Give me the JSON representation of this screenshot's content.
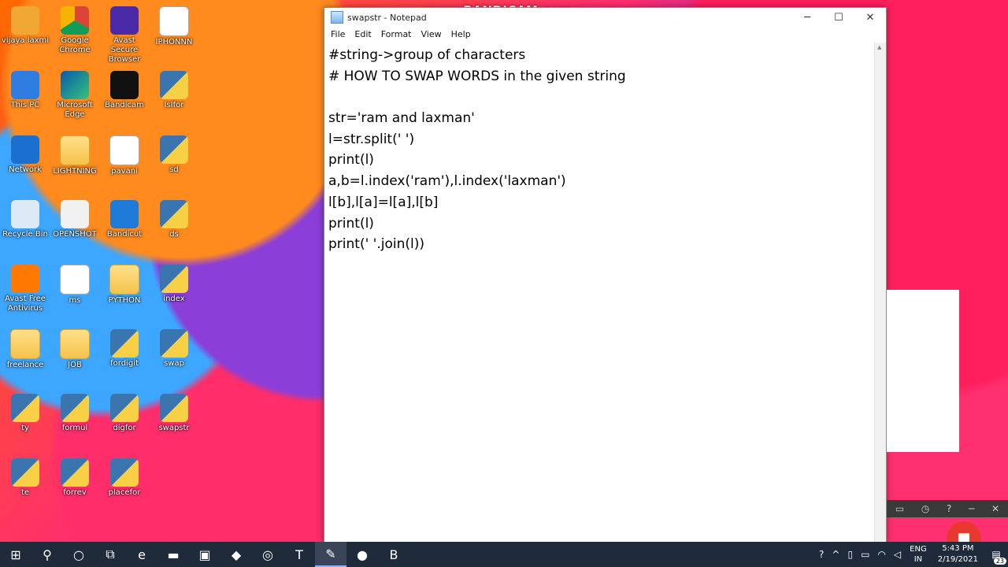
{
  "desktop_icons": [
    {
      "label": "vijaya laxmi",
      "icon": "user-folder-icon",
      "style": "g-user",
      "col": 0,
      "row": 0
    },
    {
      "label": "Google Chrome",
      "icon": "chrome-icon",
      "style": "g-chrome",
      "col": 1,
      "row": 0
    },
    {
      "label": "Avast Secure Browser",
      "icon": "avast-browser-icon",
      "style": "g-avastb",
      "col": 2,
      "row": 0
    },
    {
      "label": "IPHONNN",
      "icon": "document-icon",
      "style": "g-doc",
      "col": 3,
      "row": 0
    },
    {
      "label": "This PC",
      "icon": "computer-icon",
      "style": "g-pc",
      "col": 0,
      "row": 1
    },
    {
      "label": "Microsoft Edge",
      "icon": "edge-icon",
      "style": "g-edge",
      "col": 1,
      "row": 1
    },
    {
      "label": "Bandicam",
      "icon": "bandicam-icon",
      "style": "g-band",
      "col": 2,
      "row": 1
    },
    {
      "label": "lsIfor",
      "icon": "python-file-icon",
      "style": "g-py",
      "col": 3,
      "row": 1
    },
    {
      "label": "Network",
      "icon": "network-icon",
      "style": "g-net",
      "col": 0,
      "row": 2
    },
    {
      "label": "LIGHTNING",
      "icon": "folder-icon",
      "style": "g-folder",
      "col": 1,
      "row": 2
    },
    {
      "label": "pavani",
      "icon": "document-icon",
      "style": "g-doc",
      "col": 2,
      "row": 2
    },
    {
      "label": "sd",
      "icon": "python-file-icon",
      "style": "g-py",
      "col": 3,
      "row": 2
    },
    {
      "label": "Recycle Bin",
      "icon": "recycle-bin-icon",
      "style": "g-bin",
      "col": 0,
      "row": 3
    },
    {
      "label": "OPENSHOT",
      "icon": "openshot-icon",
      "style": "g-open",
      "col": 1,
      "row": 3
    },
    {
      "label": "Bandicut",
      "icon": "bandicut-icon",
      "style": "g-bcut",
      "col": 2,
      "row": 3
    },
    {
      "label": "ds",
      "icon": "python-file-icon",
      "style": "g-py",
      "col": 3,
      "row": 3
    },
    {
      "label": "Avast Free Antivirus",
      "icon": "avast-icon",
      "style": "g-avast",
      "col": 0,
      "row": 4
    },
    {
      "label": "ms",
      "icon": "document-icon",
      "style": "g-doc",
      "col": 1,
      "row": 4
    },
    {
      "label": "PYTHON",
      "icon": "folder-icon",
      "style": "g-folder",
      "col": 2,
      "row": 4
    },
    {
      "label": "index",
      "icon": "python-file-icon",
      "style": "g-py",
      "col": 3,
      "row": 4
    },
    {
      "label": "freelance",
      "icon": "folder-icon",
      "style": "g-folder",
      "col": 0,
      "row": 5
    },
    {
      "label": "JOB",
      "icon": "folder-icon",
      "style": "g-folder",
      "col": 1,
      "row": 5
    },
    {
      "label": "fordigit",
      "icon": "python-file-icon",
      "style": "g-py",
      "col": 2,
      "row": 5
    },
    {
      "label": "swap",
      "icon": "python-file-icon",
      "style": "g-py",
      "col": 3,
      "row": 5
    },
    {
      "label": "ty",
      "icon": "python-file-icon",
      "style": "g-py",
      "col": 0,
      "row": 6
    },
    {
      "label": "formul",
      "icon": "python-file-icon",
      "style": "g-py",
      "col": 1,
      "row": 6
    },
    {
      "label": "digfor",
      "icon": "python-file-icon",
      "style": "g-py",
      "col": 2,
      "row": 6
    },
    {
      "label": "swapstr",
      "icon": "python-file-icon",
      "style": "g-py",
      "col": 3,
      "row": 6
    },
    {
      "label": "te",
      "icon": "python-file-icon",
      "style": "g-py",
      "col": 0,
      "row": 7
    },
    {
      "label": "forrev",
      "icon": "python-file-icon",
      "style": "g-py",
      "col": 1,
      "row": 7
    },
    {
      "label": "placefor",
      "icon": "python-file-icon",
      "style": "g-py",
      "col": 2,
      "row": 7
    }
  ],
  "watermark": "www.BANDICAM.com",
  "notepad": {
    "title": "swapstr - Notepad",
    "menu": [
      "File",
      "Edit",
      "Format",
      "View",
      "Help"
    ],
    "controls": {
      "minimize": "─",
      "maximize": "☐",
      "close": "✕"
    },
    "lines": [
      "#string->group of characters",
      "# HOW TO SWAP WORDS in the given string",
      "",
      "str='ram and laxman'",
      "l=str.split(' ')",
      "print(l)",
      "a,b=l.index('ram'),l.index('laxman')",
      "l[b],l[a]=l[a],l[b]",
      "print(l)",
      "print(' '.join(l))"
    ]
  },
  "taskbar": {
    "apps": [
      {
        "name": "start-button",
        "glyph": "⊞",
        "active": false
      },
      {
        "name": "search-button",
        "glyph": "⚲",
        "active": false
      },
      {
        "name": "cortana-button",
        "glyph": "○",
        "active": false
      },
      {
        "name": "task-view-button",
        "glyph": "⧉",
        "active": false
      },
      {
        "name": "edge-taskbar-button",
        "glyph": "e",
        "active": false
      },
      {
        "name": "file-explorer-button",
        "glyph": "▬",
        "active": false
      },
      {
        "name": "store-button",
        "glyph": "▣",
        "active": false
      },
      {
        "name": "avast-browser-taskbar-button",
        "glyph": "◆",
        "active": false
      },
      {
        "name": "chrome-taskbar-button",
        "glyph": "◎",
        "active": false
      },
      {
        "name": "teams-button",
        "glyph": "T",
        "active": false
      },
      {
        "name": "notepad-taskbar-button",
        "glyph": "✎",
        "active": true
      },
      {
        "name": "bandicam-taskbar-button",
        "glyph": "●",
        "active": false
      },
      {
        "name": "bandicut-taskbar-button",
        "glyph": "B",
        "active": false
      }
    ],
    "language": {
      "line1": "ENG",
      "line2": "IN"
    },
    "time": "5:43 PM",
    "date": "2/19/2021",
    "notification_count": "23"
  }
}
